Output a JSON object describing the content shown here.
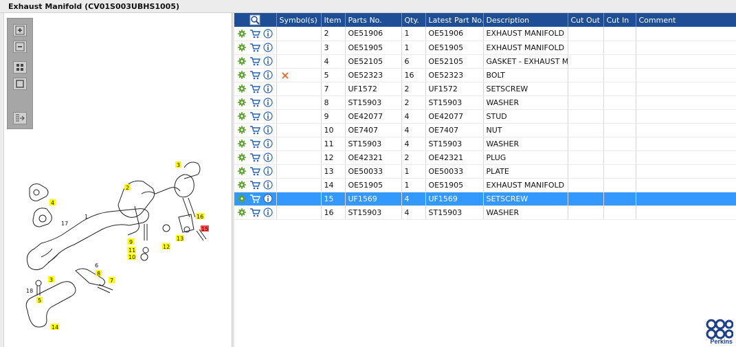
{
  "window": {
    "title": "Exhaust Manifold (CV01S003UBHS1005)"
  },
  "toolbar": {
    "buttons": [
      {
        "name": "zoom-in-button",
        "icon": "zoom-in-icon"
      },
      {
        "name": "zoom-out-button",
        "icon": "zoom-out-icon"
      },
      {
        "name": "fit-all-button",
        "icon": "fit-all-icon"
      },
      {
        "name": "fit-page-button",
        "icon": "fit-page-icon"
      },
      {
        "name": "export-list-button",
        "icon": "export-list-icon"
      }
    ]
  },
  "diagram": {
    "callouts": [
      "1",
      "2",
      "3",
      "3",
      "4",
      "5",
      "6",
      "7",
      "8",
      "9",
      "10",
      "11",
      "12",
      "13",
      "14",
      "15",
      "16",
      "17",
      "18"
    ],
    "highlight_color": "#ffff00",
    "selected_color": "#ff4b4b"
  },
  "grid": {
    "header_icon": "magnifier-icon",
    "columns": [
      "Symbol(s)",
      "Item",
      "Parts No.",
      "Qty.",
      "Latest Part No.",
      "Description",
      "Cut Out",
      "Cut In",
      "Comment"
    ],
    "rows": [
      {
        "symbol": "",
        "item": "2",
        "part_no": "OE51906",
        "qty": "1",
        "latest": "OE51906",
        "desc": "EXHAUST MANIFOLD",
        "cut_out": "",
        "cut_in": "",
        "comment": ""
      },
      {
        "symbol": "",
        "item": "3",
        "part_no": "OE51905",
        "qty": "1",
        "latest": "OE51905",
        "desc": "EXHAUST MANIFOLD",
        "cut_out": "",
        "cut_in": "",
        "comment": ""
      },
      {
        "symbol": "",
        "item": "4",
        "part_no": "OE52105",
        "qty": "6",
        "latest": "OE52105",
        "desc": "GASKET - EXHAUST MAN",
        "cut_out": "",
        "cut_in": "",
        "comment": ""
      },
      {
        "symbol": "x",
        "item": "5",
        "part_no": "OE52323",
        "qty": "16",
        "latest": "OE52323",
        "desc": "BOLT",
        "cut_out": "",
        "cut_in": "",
        "comment": ""
      },
      {
        "symbol": "",
        "item": "7",
        "part_no": "UF1572",
        "qty": "2",
        "latest": "UF1572",
        "desc": "SETSCREW",
        "cut_out": "",
        "cut_in": "",
        "comment": ""
      },
      {
        "symbol": "",
        "item": "8",
        "part_no": "ST15903",
        "qty": "2",
        "latest": "ST15903",
        "desc": "WASHER",
        "cut_out": "",
        "cut_in": "",
        "comment": ""
      },
      {
        "symbol": "",
        "item": "9",
        "part_no": "OE42077",
        "qty": "4",
        "latest": "OE42077",
        "desc": "STUD",
        "cut_out": "",
        "cut_in": "",
        "comment": ""
      },
      {
        "symbol": "",
        "item": "10",
        "part_no": "OE7407",
        "qty": "4",
        "latest": "OE7407",
        "desc": "NUT",
        "cut_out": "",
        "cut_in": "",
        "comment": ""
      },
      {
        "symbol": "",
        "item": "11",
        "part_no": "ST15903",
        "qty": "4",
        "latest": "ST15903",
        "desc": "WASHER",
        "cut_out": "",
        "cut_in": "",
        "comment": ""
      },
      {
        "symbol": "",
        "item": "12",
        "part_no": "OE42321",
        "qty": "2",
        "latest": "OE42321",
        "desc": "PLUG",
        "cut_out": "",
        "cut_in": "",
        "comment": ""
      },
      {
        "symbol": "",
        "item": "13",
        "part_no": "OE50033",
        "qty": "1",
        "latest": "OE50033",
        "desc": "PLATE",
        "cut_out": "",
        "cut_in": "",
        "comment": ""
      },
      {
        "symbol": "",
        "item": "14",
        "part_no": "OE51905",
        "qty": "1",
        "latest": "OE51905",
        "desc": "EXHAUST MANIFOLD",
        "cut_out": "",
        "cut_in": "",
        "comment": ""
      },
      {
        "symbol": "",
        "item": "15",
        "part_no": "UF1569",
        "qty": "4",
        "latest": "UF1569",
        "desc": "SETSCREW",
        "cut_out": "",
        "cut_in": "",
        "comment": "",
        "selected": true
      },
      {
        "symbol": "",
        "item": "16",
        "part_no": "ST15903",
        "qty": "4",
        "latest": "ST15903",
        "desc": "WASHER",
        "cut_out": "",
        "cut_in": "",
        "comment": ""
      }
    ],
    "row_icons": [
      "gear-icon",
      "cart-icon",
      "info-icon"
    ],
    "header_color": "#1e4e96",
    "selected_row_color": "#3399ff"
  },
  "brand": {
    "name": "Perkins",
    "color": "#1d3f8a"
  }
}
